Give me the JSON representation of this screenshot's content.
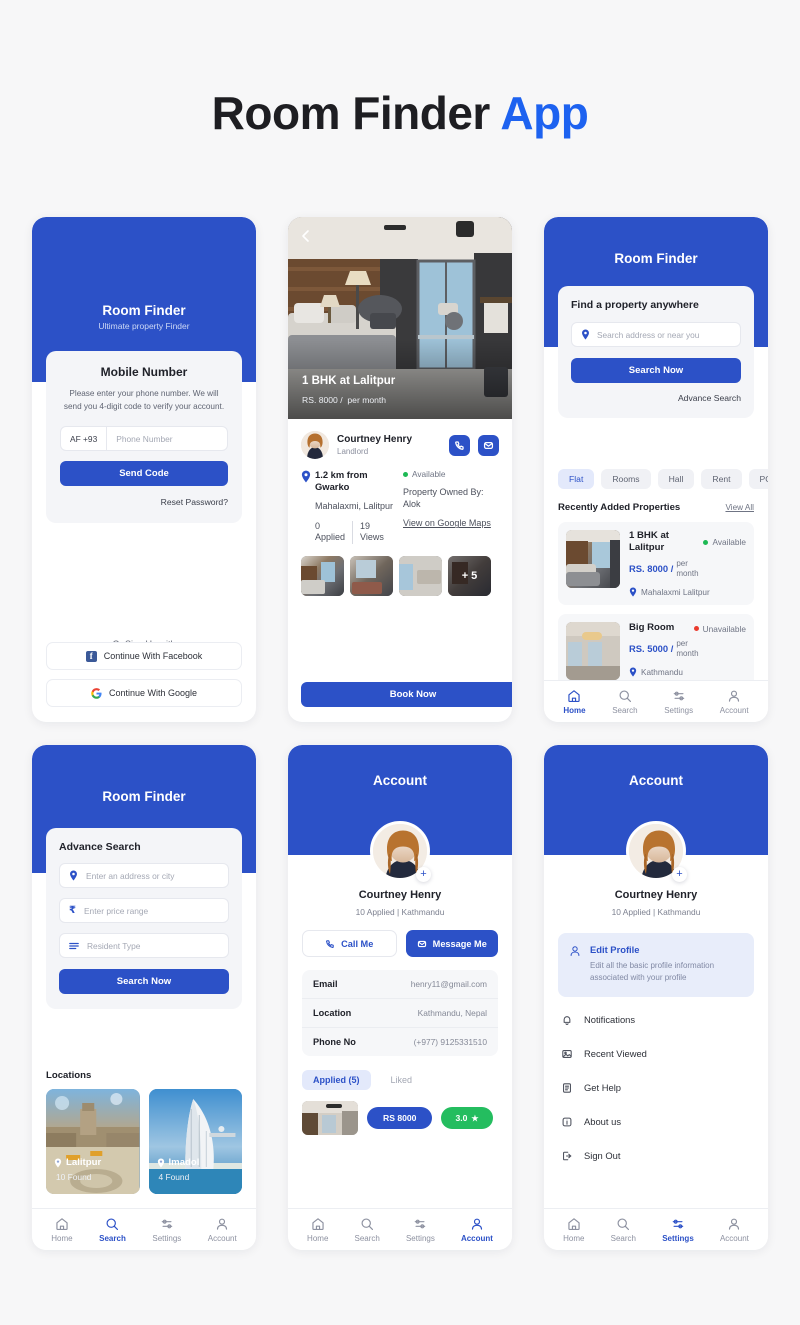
{
  "title": {
    "main": "Room Finder ",
    "accent": "App"
  },
  "colors": {
    "primary": "#2c51c7",
    "accent": "#1d62f0",
    "available": "#1db954",
    "unavailable": "#ea3b2e",
    "rating": "#24bd5f"
  },
  "screen_login": {
    "brand": "Room Finder",
    "tagline": "Ultimate property Finder",
    "card_title": "Mobile Number",
    "description": "Please enter your phone number. We will send you 4-digit code to verify your account.",
    "country_code": "AF +93",
    "phone_placeholder": "Phone Number",
    "send_code": "Send Code",
    "reset_password": "Reset Password?",
    "or_signup": "Or Sign Up with",
    "facebook": "Continue With Facebook",
    "google": "Continue With Google"
  },
  "screen_detail": {
    "back_icon": "chevron-left-icon",
    "hero_title": "1 BHK at Lalitpur",
    "hero_price": "RS. 8000 /",
    "hero_period": "per month",
    "owner_name": "Courtney Henry",
    "owner_role": "Landlord",
    "call_icon": "phone-icon",
    "message_icon": "mail-icon",
    "distance": "1.2 km from Gwarko",
    "address": "Mahalaxmi, Lalitpur",
    "applied_count": "0",
    "applied_label": "Applied",
    "views_count": "19",
    "views_label": "Views",
    "status": "Available",
    "owned_by": "Property Owned By: Alok",
    "map_link": "View on Google Maps",
    "more_photos": "+ 5",
    "book_now": "Book Now"
  },
  "screen_home": {
    "brand": "Room Finder",
    "card_title": "Find a property anywhere",
    "search_placeholder": "Search address or near you",
    "search_now": "Search Now",
    "advance_search": "Advance Search",
    "chips": [
      "Flat",
      "Rooms",
      "Hall",
      "Rent",
      "PG"
    ],
    "active_chip": "Flat",
    "section_title": "Recently Added Properties",
    "view_all": "View All",
    "properties": [
      {
        "name": "1 BHK at Lalitpur",
        "price": "RS. 8000 /",
        "period": "per month",
        "status": "Available",
        "status_type": "available",
        "location": "Mahalaxmi Lalitpur"
      },
      {
        "name": "Big Room",
        "price": "RS. 5000 /",
        "period": "per month",
        "status": "Unavailable",
        "status_type": "unavailable",
        "location": "Kathmandu"
      }
    ],
    "nav": [
      {
        "label": "Home",
        "icon": "home-icon",
        "active": true
      },
      {
        "label": "Search",
        "icon": "search-icon",
        "active": false
      },
      {
        "label": "Settings",
        "icon": "sliders-icon",
        "active": false
      },
      {
        "label": "Account",
        "icon": "user-icon",
        "active": false
      }
    ]
  },
  "screen_advance": {
    "brand": "Room Finder",
    "card_title": "Advance Search",
    "fields": [
      {
        "placeholder": "Enter an address or city",
        "icon": "location-pin-icon"
      },
      {
        "placeholder": "Enter price range",
        "icon": "rupee-icon"
      },
      {
        "placeholder": "Resident Type",
        "icon": "list-icon"
      }
    ],
    "search_now": "Search Now",
    "locations_title": "Locations",
    "locations": [
      {
        "name": "Lalitpur",
        "found": "10 Found"
      },
      {
        "name": "Imadol",
        "found": "4 Found"
      }
    ],
    "nav": [
      {
        "label": "Home",
        "icon": "home-icon",
        "active": false
      },
      {
        "label": "Search",
        "icon": "search-icon",
        "active": true
      },
      {
        "label": "Settings",
        "icon": "sliders-icon",
        "active": false
      },
      {
        "label": "Account",
        "icon": "user-icon",
        "active": false
      }
    ]
  },
  "screen_account": {
    "header_title": "Account",
    "add_photo_icon": "plus-icon",
    "user_name": "Courtney Henry",
    "user_meta": "10 Applied  |  Kathmandu",
    "call_me": "Call Me",
    "message_me": "Message Me",
    "info": [
      {
        "key": "Email",
        "value": "henry11@gmail.com"
      },
      {
        "key": "Location",
        "value": "Kathmandu, Nepal"
      },
      {
        "key": "Phone No",
        "value": "(+977) 9125331510"
      }
    ],
    "tabs": [
      {
        "label": "Applied (5)",
        "active": true
      },
      {
        "label": "Liked",
        "active": false
      }
    ],
    "applied_price": "RS 8000",
    "applied_rating": "3.0",
    "rating_icon": "star-icon",
    "nav": [
      {
        "label": "Home",
        "icon": "home-icon",
        "active": false
      },
      {
        "label": "Search",
        "icon": "search-icon",
        "active": false
      },
      {
        "label": "Settings",
        "icon": "sliders-icon",
        "active": false
      },
      {
        "label": "Account",
        "icon": "user-icon",
        "active": true
      }
    ]
  },
  "screen_settings": {
    "header_title": "Account",
    "add_photo_icon": "plus-icon",
    "user_name": "Courtney Henry",
    "user_meta": "10 Applied  |  Kathmandu",
    "highlight": {
      "title": "Edit Profile",
      "subtitle": "Edit all the basic profile information associated with your profile",
      "icon": "user-icon"
    },
    "items": [
      {
        "label": "Notifications",
        "icon": "bell-icon"
      },
      {
        "label": "Recent Viewed",
        "icon": "image-icon"
      },
      {
        "label": "Get Help",
        "icon": "book-icon"
      },
      {
        "label": "About us",
        "icon": "info-icon"
      },
      {
        "label": "Sign Out",
        "icon": "logout-icon"
      }
    ],
    "nav": [
      {
        "label": "Home",
        "icon": "home-icon",
        "active": false
      },
      {
        "label": "Search",
        "icon": "search-icon",
        "active": false
      },
      {
        "label": "Settings",
        "icon": "sliders-icon",
        "active": true
      },
      {
        "label": "Account",
        "icon": "user-icon",
        "active": false
      }
    ]
  }
}
